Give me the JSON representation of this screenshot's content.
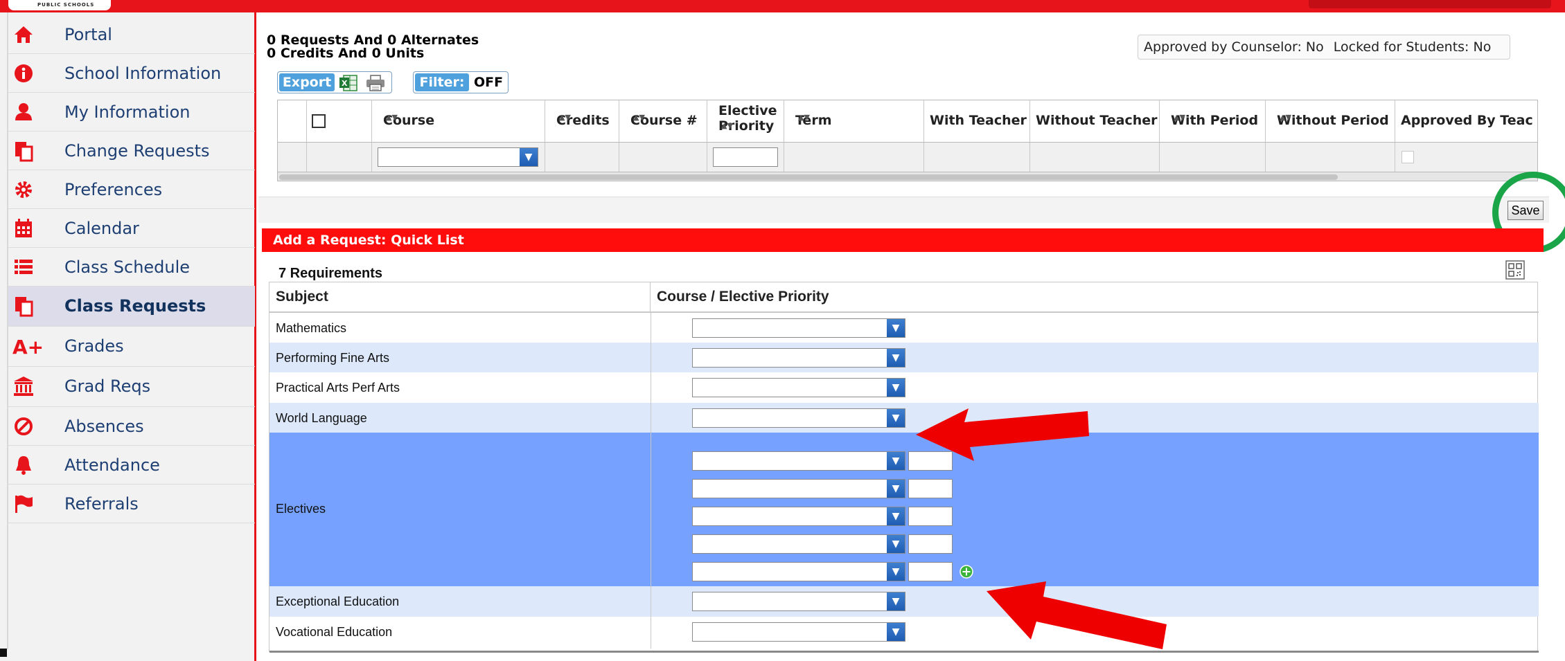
{
  "header": {
    "logo_text": "PUBLIC SCHOOLS"
  },
  "sidebar": {
    "items": [
      {
        "label": "Portal",
        "icon": "home-icon"
      },
      {
        "label": "School Information",
        "icon": "info-icon"
      },
      {
        "label": "My Information",
        "icon": "user-icon"
      },
      {
        "label": "Change Requests",
        "icon": "documents-icon"
      },
      {
        "label": "Preferences",
        "icon": "gear-icon"
      },
      {
        "label": "Calendar",
        "icon": "calendar-icon"
      },
      {
        "label": "Class Schedule",
        "icon": "list-icon"
      },
      {
        "label": "Class Requests",
        "icon": "documents-icon",
        "active": true
      },
      {
        "label": "Grades",
        "icon": "grade-a-plus-icon"
      },
      {
        "label": "Grad Reqs",
        "icon": "bank-icon"
      },
      {
        "label": "Absences",
        "icon": "no-entry-icon"
      },
      {
        "label": "Attendance",
        "icon": "bell-icon"
      },
      {
        "label": "Referrals",
        "icon": "flag-icon"
      }
    ]
  },
  "summary": {
    "line1": "0 Requests And 0 Alternates",
    "line2": "0 Credits And 0 Units"
  },
  "status": {
    "approved": "Approved by Counselor: No",
    "locked": "Locked for Students: No"
  },
  "toolbar": {
    "export_label": "Export",
    "filter_label": "Filter:",
    "filter_value": "OFF"
  },
  "request_table": {
    "columns": {
      "course": "Course",
      "credits": "Credits",
      "course_num": "Course #",
      "elective_priority_1": "Elective",
      "elective_priority_2": "Priority",
      "term": "Term",
      "with_teacher": "With Teacher",
      "without_teacher": "Without Teacher",
      "with_period": "With Period",
      "without_period": "Without Period",
      "approved_by_teacher": "Approved By Teac"
    }
  },
  "save_label": "Save",
  "quick_list": {
    "title": "Add a Request: Quick List",
    "count_label": "7 Requirements",
    "col_subject": "Subject",
    "col_course": "Course / Elective Priority",
    "rows": [
      {
        "subject": "Mathematics"
      },
      {
        "subject": "Performing Fine Arts"
      },
      {
        "subject": "Practical Arts Perf Arts"
      },
      {
        "subject": "World Language"
      },
      {
        "subject": "Electives"
      },
      {
        "subject": "Exceptional Education"
      },
      {
        "subject": "Vocational Education"
      }
    ]
  },
  "colors": {
    "brand_red": "#e8141b",
    "header_red": "#ff0d0d",
    "selected_row": "#76a1ff",
    "alt_row": "#dde9fb",
    "highlight_green": "#1aa648",
    "button_blue": "#4ea1dc"
  }
}
